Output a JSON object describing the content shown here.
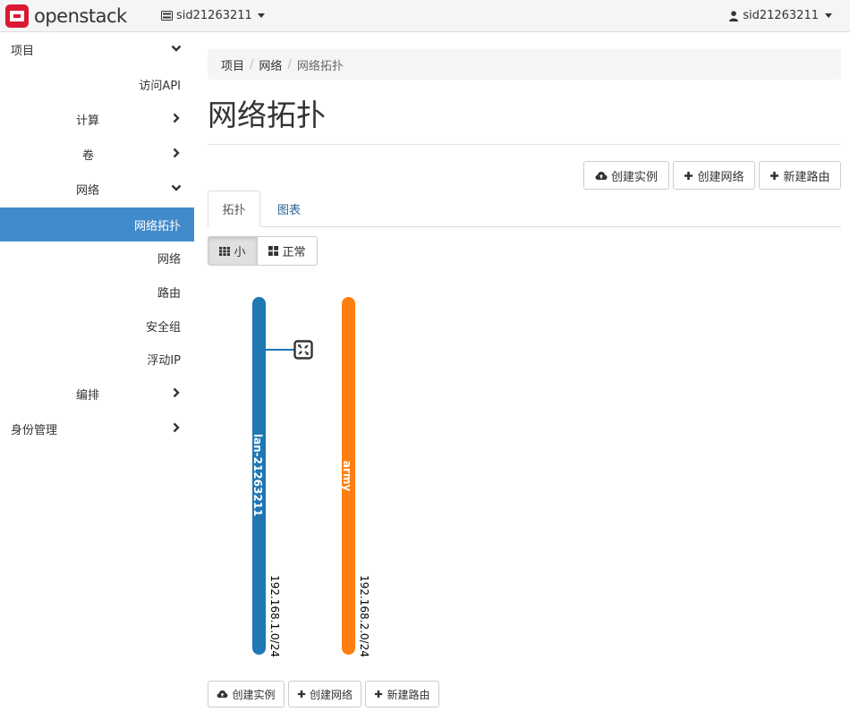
{
  "topbar": {
    "logo_text": "openstack",
    "project": "sid21263211",
    "user": "sid21263211"
  },
  "sidebar": {
    "items": [
      {
        "label": "项目",
        "chevron": "down"
      },
      {
        "label": "访问API"
      },
      {
        "label": "计算",
        "chevron": "right"
      },
      {
        "label": "卷",
        "chevron": "right"
      },
      {
        "label": "网络",
        "chevron": "down"
      },
      {
        "label": "网络拓扑",
        "active": true
      },
      {
        "label": "网络"
      },
      {
        "label": "路由"
      },
      {
        "label": "安全组"
      },
      {
        "label": "浮动IP"
      },
      {
        "label": "编排",
        "chevron": "right"
      },
      {
        "label": "身份管理",
        "chevron": "right"
      }
    ]
  },
  "breadcrumb": [
    "项目",
    "网络",
    "网络拓扑"
  ],
  "page_title": "网络拓扑",
  "actions": {
    "create_instance": "创建实例",
    "create_network": "创建网络",
    "create_router": "新建路由"
  },
  "tabs": [
    "拓扑",
    "图表"
  ],
  "view_toggle": {
    "small": "小",
    "normal": "正常",
    "selected": "small"
  },
  "networks": [
    {
      "name": "lan-21263211",
      "cidr": "192.168.1.0/24",
      "color": "#1f77b4"
    },
    {
      "name": "army",
      "cidr": "192.168.2.0/24",
      "color": "#ff7f0e"
    }
  ],
  "colors": {
    "accent": "#428bca",
    "link": "#2a6496"
  }
}
